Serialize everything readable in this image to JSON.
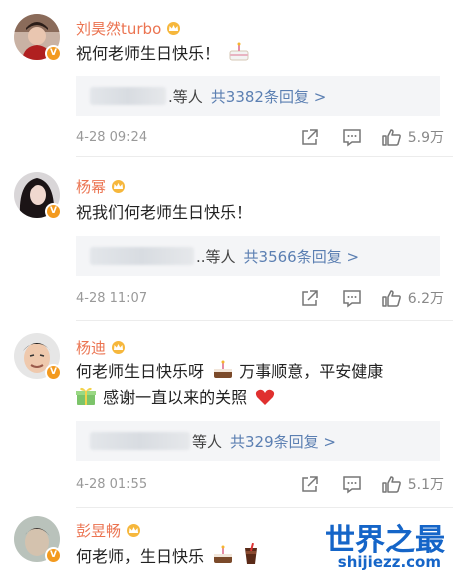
{
  "comments": [
    {
      "name": "刘昊然turbo",
      "text": "祝何老师生日快乐！",
      "emojis": [
        "cake"
      ],
      "reply_others": ".等人",
      "reply_link": "共3382条回复 >",
      "time": "4-28 09:24",
      "like_count": "5.9万"
    },
    {
      "name": "杨幂",
      "text": "祝我们何老师生日快乐！",
      "emojis": [],
      "reply_others": "..等人",
      "reply_link": "共3566条回复 >",
      "time": "4-28 11:07",
      "like_count": "6.2万"
    },
    {
      "name": "杨迪",
      "text": "何老师生日快乐呀",
      "text_after": "万事顺意，平安健康",
      "text_line2": "感谢一直以来的关照",
      "emojis": [
        "cake",
        "gift",
        "heart"
      ],
      "reply_others": "等人",
      "reply_link": "共329条回复 >",
      "time": "4-28 01:55",
      "like_count": "5.1万"
    },
    {
      "name": "彭昱畅",
      "text": "何老师，生日快乐",
      "emojis": [
        "cake",
        "drink"
      ]
    }
  ],
  "icons": {
    "share": "share-icon",
    "comment": "comment-icon",
    "like": "thumbs-up-icon",
    "crown": "crown-icon",
    "verified": "verified-badge-icon"
  },
  "colors": {
    "name": "#eb7350",
    "link": "#5b7fb2",
    "badge": "#f39a1f",
    "watermark": "#1565c8"
  },
  "verified_badge": "V",
  "watermark": {
    "title": "世界之最",
    "url": "shijiezz.com"
  }
}
